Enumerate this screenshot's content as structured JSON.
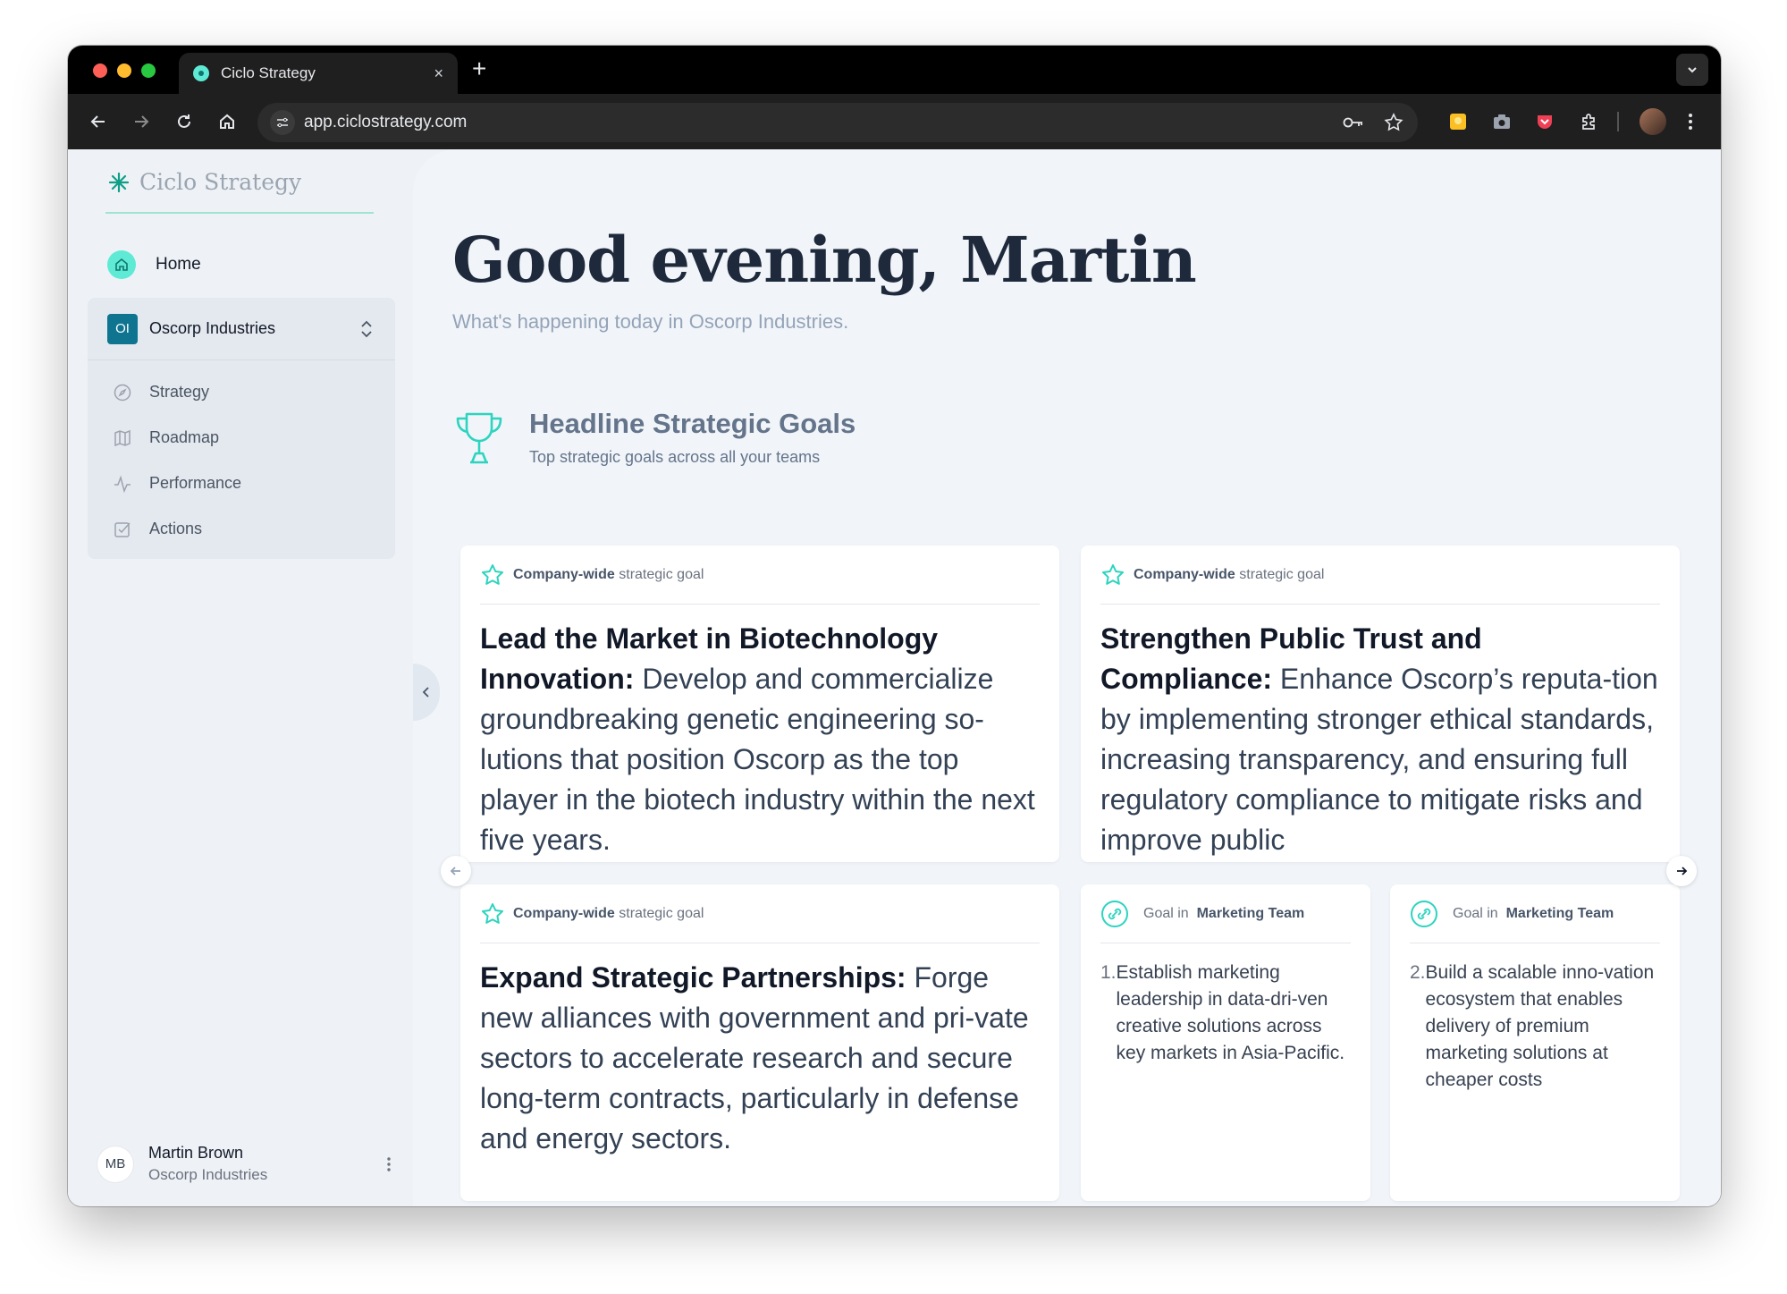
{
  "browser": {
    "tab_title": "Ciclo Strategy",
    "url": "app.ciclostrategy.com",
    "new_tab": "+",
    "close": "×"
  },
  "sidebar": {
    "brand": "Ciclo Strategy",
    "home": "Home",
    "org": {
      "badge": "OI",
      "name": "Oscorp Industries"
    },
    "nav": [
      {
        "label": "Strategy",
        "icon": "compass-icon"
      },
      {
        "label": "Roadmap",
        "icon": "map-icon"
      },
      {
        "label": "Performance",
        "icon": "activity-icon"
      },
      {
        "label": "Actions",
        "icon": "checkbox-icon"
      }
    ],
    "user": {
      "initials": "MB",
      "name": "Martin Brown",
      "org": "Oscorp Industries"
    }
  },
  "main": {
    "greeting": "Good evening, Martin",
    "subtitle": "What's happening today in Oscorp Industries.",
    "section": {
      "title": "Headline Strategic Goals",
      "subtitle": "Top strategic goals across all your teams"
    },
    "goals": [
      {
        "scope": "Company-wide",
        "kind": "strategic goal",
        "title": "Lead the Market in Biotechnology Innovation:",
        "text": "Develop and commercialize groundbreaking genetic engineering so-lutions that position Oscorp as the top player in the biotech industry within the next five years."
      },
      {
        "scope": "Company-wide",
        "kind": "strategic goal",
        "title": "Strengthen Public Trust and Compliance:",
        "text": "Enhance Oscorp’s reputa-tion by implementing stronger ethical standards, increasing transparency, and ensuring full regulatory compliance to mitigate risks and improve public"
      },
      {
        "scope": "Company-wide",
        "kind": "strategic goal",
        "title": "Expand Strategic Partnerships:",
        "text": "Forge new alliances with government and pri-vate sectors to accelerate research and secure long-term contracts, particularly in defense and energy sectors."
      }
    ],
    "team_goals": [
      {
        "prefix": "Goal in",
        "team": "Marketing Team",
        "number": "1.",
        "text": "Establish marketing leadership in data-dri-ven creative solutions across key markets in Asia-Pacific."
      },
      {
        "prefix": "Goal in",
        "team": "Marketing Team",
        "number": "2.",
        "text": "Build a scalable inno-vation ecosystem that enables delivery of premium marketing solutions at cheaper costs"
      }
    ]
  },
  "colors": {
    "accent": "#5eead4",
    "accent_dark": "#2dd4bf",
    "org_badge": "#0e7490"
  }
}
